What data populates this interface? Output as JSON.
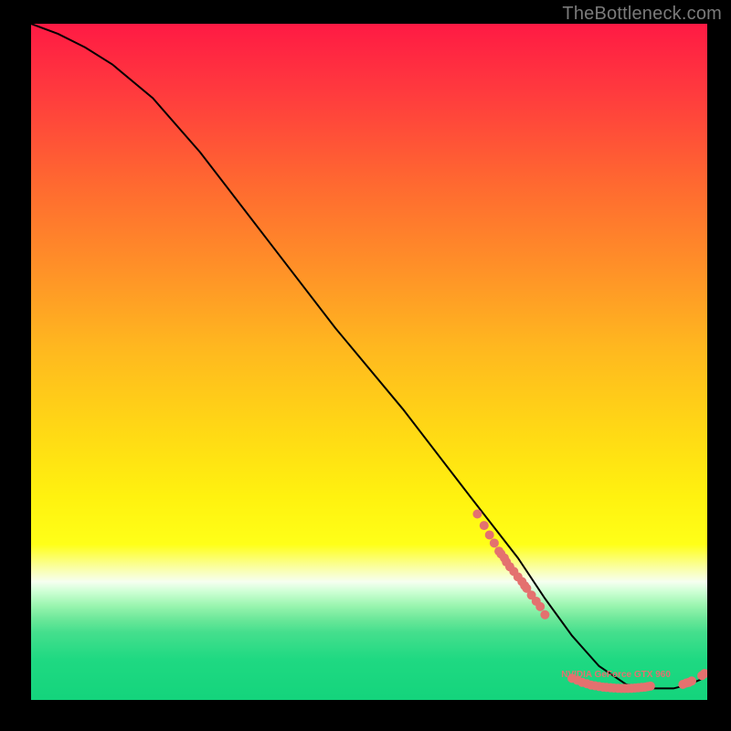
{
  "watermark": "TheBottleneck.com",
  "chart_data": {
    "type": "line",
    "title": "",
    "xlabel": "",
    "ylabel": "",
    "xlim": [
      0,
      100
    ],
    "ylim": [
      0,
      100
    ],
    "series": [
      {
        "name": "bottleneck-curve",
        "x": [
          0,
          4,
          8,
          12,
          18,
          25,
          35,
          45,
          55,
          65,
          72,
          76,
          80,
          84,
          88,
          92,
          95,
          97,
          99,
          100
        ],
        "y": [
          100,
          98.5,
          96.5,
          94,
          89,
          81,
          68,
          55,
          43,
          30,
          21,
          15,
          9.5,
          5,
          2.3,
          1.7,
          1.7,
          2.2,
          3.0,
          4.0
        ]
      }
    ],
    "scatter_clusters": [
      {
        "name": "left-cluster",
        "points": [
          {
            "x": 66,
            "y": 27.5
          },
          {
            "x": 67,
            "y": 25.8
          },
          {
            "x": 67.8,
            "y": 24.4
          },
          {
            "x": 68.5,
            "y": 23.2
          },
          {
            "x": 69.2,
            "y": 22.0
          },
          {
            "x": 69.5,
            "y": 21.6
          },
          {
            "x": 70.0,
            "y": 21.0
          },
          {
            "x": 70.3,
            "y": 20.4
          },
          {
            "x": 70.8,
            "y": 19.7
          },
          {
            "x": 71.4,
            "y": 19.0
          },
          {
            "x": 72.0,
            "y": 18.2
          },
          {
            "x": 72.6,
            "y": 17.5
          },
          {
            "x": 73.0,
            "y": 16.9
          },
          {
            "x": 73.3,
            "y": 16.5
          },
          {
            "x": 74.0,
            "y": 15.5
          },
          {
            "x": 74.7,
            "y": 14.6
          },
          {
            "x": 75.3,
            "y": 13.8
          },
          {
            "x": 76.0,
            "y": 12.6
          }
        ]
      },
      {
        "name": "bottom-cluster",
        "points": [
          {
            "x": 80.0,
            "y": 3.2
          },
          {
            "x": 80.8,
            "y": 2.9
          },
          {
            "x": 81.5,
            "y": 2.6
          },
          {
            "x": 82.2,
            "y": 2.4
          },
          {
            "x": 82.8,
            "y": 2.2
          },
          {
            "x": 83.4,
            "y": 2.1
          },
          {
            "x": 84.0,
            "y": 2.0
          },
          {
            "x": 84.6,
            "y": 1.9
          },
          {
            "x": 85.1,
            "y": 1.85
          },
          {
            "x": 85.7,
            "y": 1.8
          },
          {
            "x": 86.2,
            "y": 1.75
          },
          {
            "x": 86.8,
            "y": 1.72
          },
          {
            "x": 87.3,
            "y": 1.7
          },
          {
            "x": 87.8,
            "y": 1.7
          },
          {
            "x": 88.3,
            "y": 1.7
          },
          {
            "x": 88.8,
            "y": 1.72
          },
          {
            "x": 89.3,
            "y": 1.75
          },
          {
            "x": 89.8,
            "y": 1.8
          },
          {
            "x": 90.3,
            "y": 1.85
          },
          {
            "x": 90.8,
            "y": 1.9
          },
          {
            "x": 91.2,
            "y": 1.98
          },
          {
            "x": 91.6,
            "y": 2.05
          }
        ]
      },
      {
        "name": "right-cluster",
        "points": [
          {
            "x": 96.4,
            "y": 2.3
          },
          {
            "x": 96.9,
            "y": 2.5
          },
          {
            "x": 97.3,
            "y": 2.6
          },
          {
            "x": 97.7,
            "y": 2.8
          },
          {
            "x": 99.2,
            "y": 3.6
          },
          {
            "x": 99.6,
            "y": 3.9
          }
        ]
      }
    ],
    "label_on_curve": {
      "text": "NVIDIA GeForce GTX 960",
      "x": 86.5,
      "y": 3.4
    },
    "colors": {
      "curve": "#000000",
      "dots": "#e4716f",
      "label": "#e4716f"
    }
  }
}
